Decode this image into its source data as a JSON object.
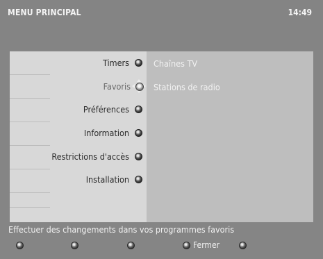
{
  "header": {
    "title": "MENU PRINCIPAL",
    "clock": "14:49"
  },
  "menu": {
    "items": [
      {
        "label": "Timers",
        "icon": "knob-icon"
      },
      {
        "label": "Favoris",
        "icon": "navigation-cursor-icon",
        "active": true
      },
      {
        "label": "Préférences",
        "icon": "knob-icon"
      },
      {
        "label": "Information",
        "icon": "knob-icon"
      },
      {
        "label": "Restrictions d'accès",
        "icon": "knob-icon"
      },
      {
        "label": "Installation",
        "icon": "knob-icon"
      }
    ]
  },
  "submenu": {
    "items": [
      {
        "label": "Chaînes TV"
      },
      {
        "label": "Stations de radio"
      }
    ]
  },
  "status": {
    "text": "Effectuer des changements dans vos programmes favoris"
  },
  "footer": {
    "keys": [
      {
        "label": ""
      },
      {
        "label": ""
      },
      {
        "label": ""
      },
      {
        "label": "Fermer"
      },
      {
        "label": ""
      }
    ]
  },
  "colors": {
    "background": "#858585",
    "left_panel": "#d8d8d8",
    "right_panel": "#bebebe",
    "text_light": "#f0f0f0",
    "text_dark": "#2b2b2b"
  }
}
